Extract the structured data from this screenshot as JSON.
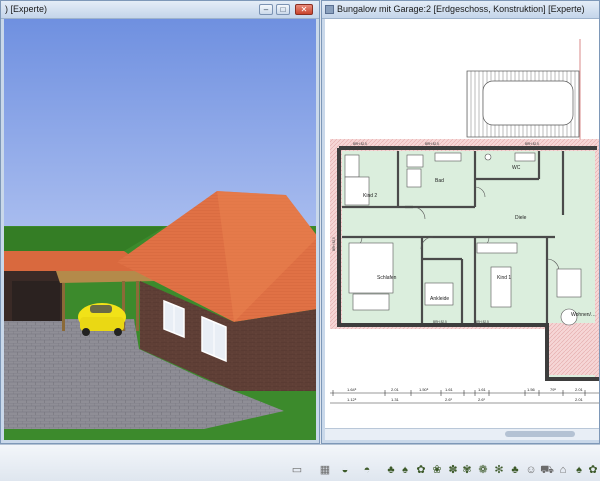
{
  "left_window": {
    "title": ") [Experte)"
  },
  "right_window": {
    "title": "Bungalow mit Garage:2 [Erdgeschoss, Konstruktion] [Experte)",
    "menu_icon": "system-menu-icon"
  },
  "plan": {
    "rooms": {
      "bad": "Bad",
      "wc": "WC",
      "kind2": "Kind 2",
      "diele": "Diele",
      "schlafen": "Schlafen",
      "ankleide": "Ankleide",
      "kind1": "Kind 1",
      "wohnen": "Wohnen/…"
    },
    "parapet_labels": {
      "top_left": "BRH 82,5",
      "top_mid": "BRH 82,5",
      "top_right": "BRH 82,5",
      "bottom_left": "BRH 82,5",
      "bottom_mid": "BRH 82,5",
      "side": "BRH 82,5"
    },
    "dimensions_row1": [
      "1.64⁵",
      "2.01",
      "1.50⁵",
      "1.61",
      "1.61",
      "1.56",
      "79⁵",
      "2.01"
    ],
    "dimensions_row2": [
      "1.12⁵",
      "1.31",
      "2.6¹",
      "2.6¹",
      "2.01"
    ]
  },
  "taskbar": {
    "tools": [
      "folder-icon",
      "grid-icon",
      "terrain-icon",
      "tree-icon",
      "tree-icon",
      "plant-icon",
      "bush-icon",
      "flower-icon",
      "flower-icon",
      "plant-icon",
      "bush-icon",
      "tree-icon",
      "person-icon",
      "car-icon",
      "bench-icon",
      "tree-icon",
      "flower-icon"
    ]
  },
  "colors": {
    "sky": "#7d9ee8",
    "lawn": "#3c8a2c",
    "roof": "#e07145",
    "brick": "#5a3b33",
    "paving": "#8f8e96",
    "car": "#f1e218",
    "room_fill": "#dbeedd",
    "wall": "#444444",
    "hatch": "#f0c4c4"
  }
}
